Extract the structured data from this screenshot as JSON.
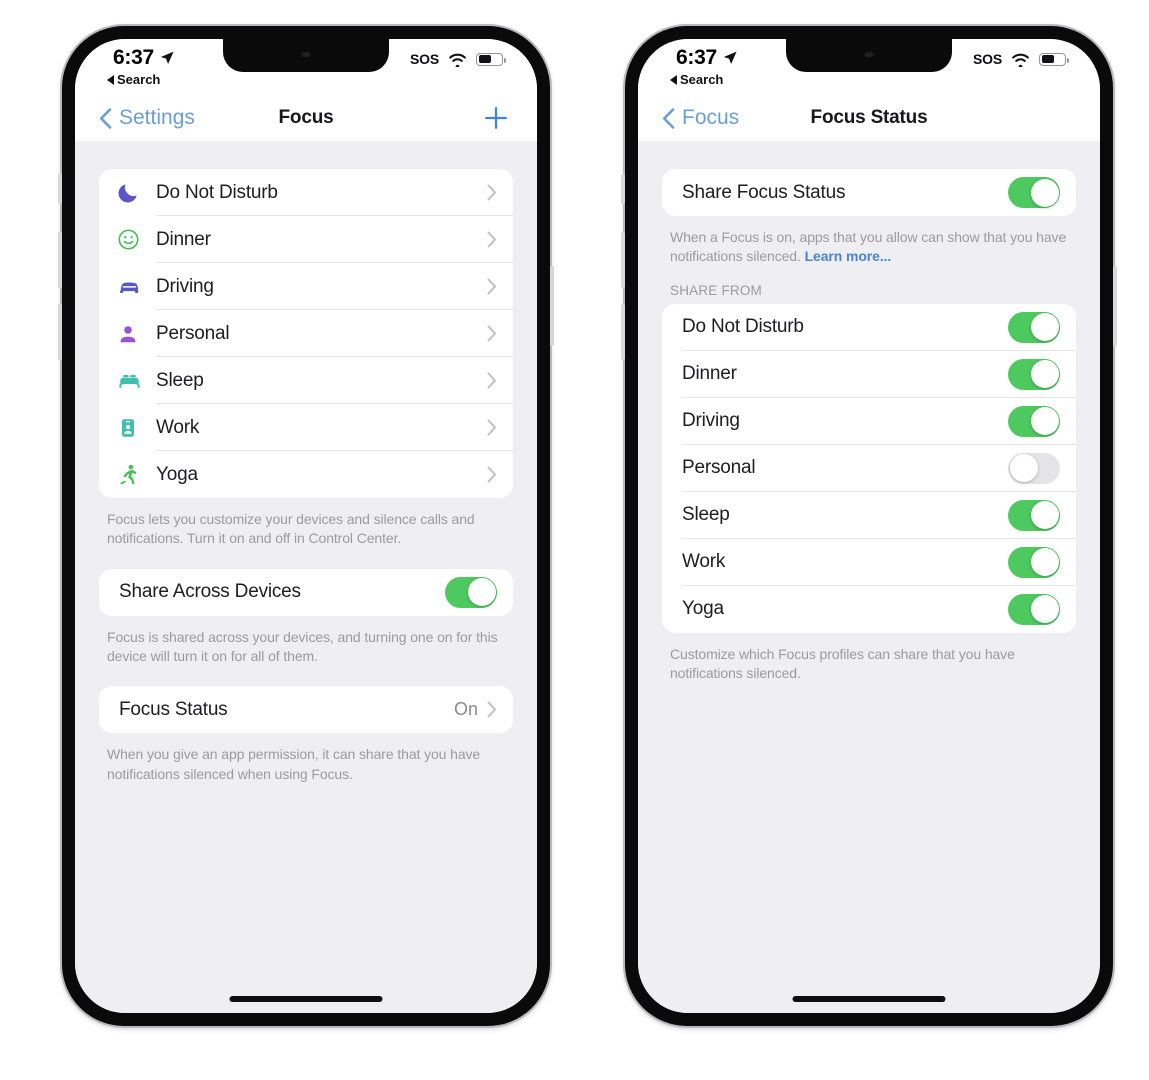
{
  "status_bar": {
    "time": "6:37",
    "back_label": "Search",
    "sos_label": "SOS",
    "location_icon": "location-arrow-icon",
    "wifi_icon": "wifi-icon",
    "battery_icon": "battery-icon",
    "battery_level_percent": 50
  },
  "colors": {
    "accent_blue": "#6a9fd4",
    "link_blue": "#4c84c8",
    "toggle_on_green": "#4ec95f",
    "toggle_off_gray": "#e5e5e8",
    "screen_background": "#eeeef3",
    "card_background": "#ffffff",
    "secondary_text": "#9a9aa1",
    "icon_indigo": "#5b56c8",
    "icon_purple": "#9a52d8",
    "icon_green": "#45c158",
    "icon_teal": "#3fbfb0"
  },
  "left_phone": {
    "nav": {
      "back_label": "Settings",
      "title": "Focus",
      "add_label": "+"
    },
    "focus_list": [
      {
        "label": "Do Not Disturb",
        "icon": "moon-icon",
        "color": "#5b56c8"
      },
      {
        "label": "Dinner",
        "icon": "smiley-face-icon",
        "color": "#45c158"
      },
      {
        "label": "Driving",
        "icon": "car-icon",
        "color": "#5b56c8"
      },
      {
        "label": "Personal",
        "icon": "person-icon",
        "color": "#9a52d8"
      },
      {
        "label": "Sleep",
        "icon": "bed-icon",
        "color": "#3fbfb0"
      },
      {
        "label": "Work",
        "icon": "work-badge-icon",
        "color": "#3fbfb0"
      },
      {
        "label": "Yoga",
        "icon": "running-person-icon",
        "color": "#45c158"
      }
    ],
    "focus_list_footer": "Focus lets you customize your devices and silence calls and notifications. Turn it on and off in Control Center.",
    "share_across_devices": {
      "label": "Share Across Devices",
      "enabled": true
    },
    "share_across_devices_footer": "Focus is shared across your devices, and turning one on for this device will turn it on for all of them.",
    "focus_status": {
      "label": "Focus Status",
      "value": "On"
    },
    "focus_status_footer": "When you give an app permission, it can share that you have notifications silenced when using Focus."
  },
  "right_phone": {
    "nav": {
      "back_label": "Focus",
      "title": "Focus Status"
    },
    "share_focus_status": {
      "label": "Share Focus Status",
      "enabled": true
    },
    "share_focus_status_footer": "When a Focus is on, apps that you allow can show that you have notifications silenced. ",
    "share_focus_status_footer_link": "Learn more...",
    "share_from_header": "SHARE FROM",
    "share_from_list": [
      {
        "label": "Do Not Disturb",
        "enabled": true
      },
      {
        "label": "Dinner",
        "enabled": true
      },
      {
        "label": "Driving",
        "enabled": true
      },
      {
        "label": "Personal",
        "enabled": false
      },
      {
        "label": "Sleep",
        "enabled": true
      },
      {
        "label": "Work",
        "enabled": true
      },
      {
        "label": "Yoga",
        "enabled": true
      }
    ],
    "share_from_footer": "Customize which Focus profiles can share that you have notifications silenced."
  }
}
